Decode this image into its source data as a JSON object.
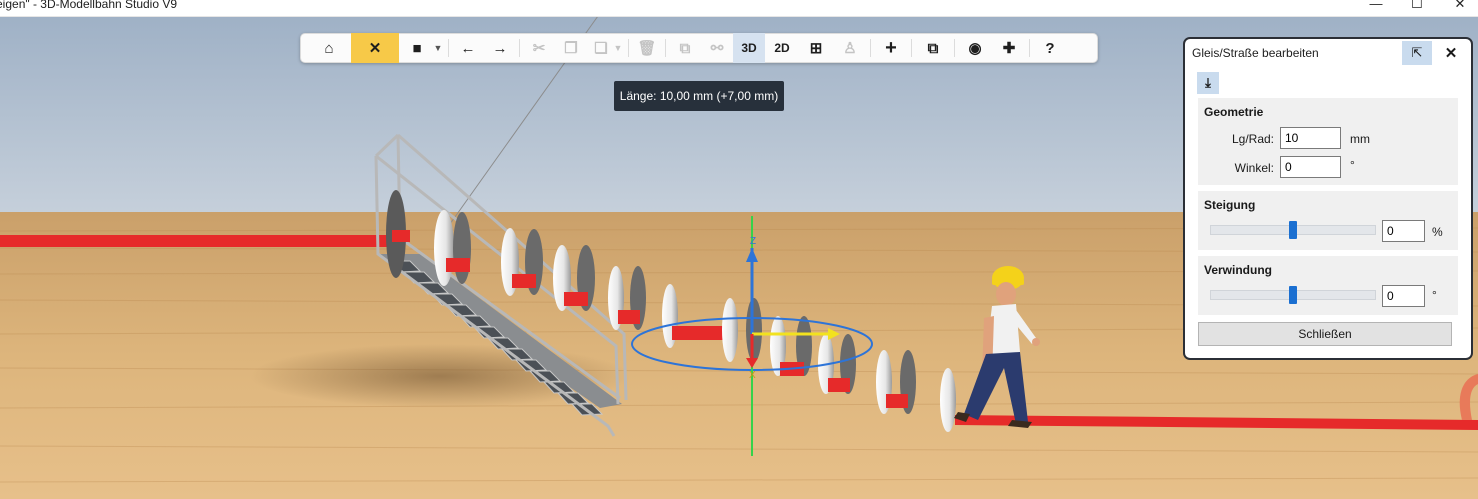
{
  "window": {
    "title": "eigen\" - 3D-Modellbahn Studio V9",
    "minimize": "—",
    "maximize": "☐",
    "close": "✕"
  },
  "toolbar": {
    "home": "⌂",
    "tools": "✕",
    "save": "■",
    "undo": "←",
    "redo": "→",
    "cut": "✂",
    "copy": "❐",
    "paste": "❏",
    "delete": "🗑",
    "group": "⧉",
    "link": "⚯",
    "view3d": "3D",
    "view2d": "2D",
    "grid": "⊞",
    "lamp": "♙",
    "add": "+",
    "window": "⧉",
    "camera": "◉",
    "plugin": "✚",
    "help": "?"
  },
  "tooltip": {
    "text": "Länge: 10,00 mm (+7,00 mm)"
  },
  "panel": {
    "title": "Gleis/Straße bearbeiten",
    "popout_icon": "⇱",
    "close_icon": "✕",
    "download_icon": "⤓",
    "geometry": {
      "heading": "Geometrie",
      "length_label": "Lg/Rad:",
      "length_value": "10",
      "length_unit": "mm",
      "angle_label": "Winkel:",
      "angle_value": "0",
      "angle_unit": "°"
    },
    "slope": {
      "heading": "Steigung",
      "value": "0",
      "unit": "%",
      "slider_position": 0.5
    },
    "twist": {
      "heading": "Verwindung",
      "value": "0",
      "unit": "°",
      "slider_position": 0.5
    },
    "close_button": "Schließen"
  },
  "colors": {
    "toolbar_active": "#f7c948",
    "toolbar_pressed": "#d6e2f0",
    "slider_thumb": "#1a6fd1",
    "track": "#e8262a",
    "ground": "#d8a868",
    "sky": "#b3c2d2"
  }
}
